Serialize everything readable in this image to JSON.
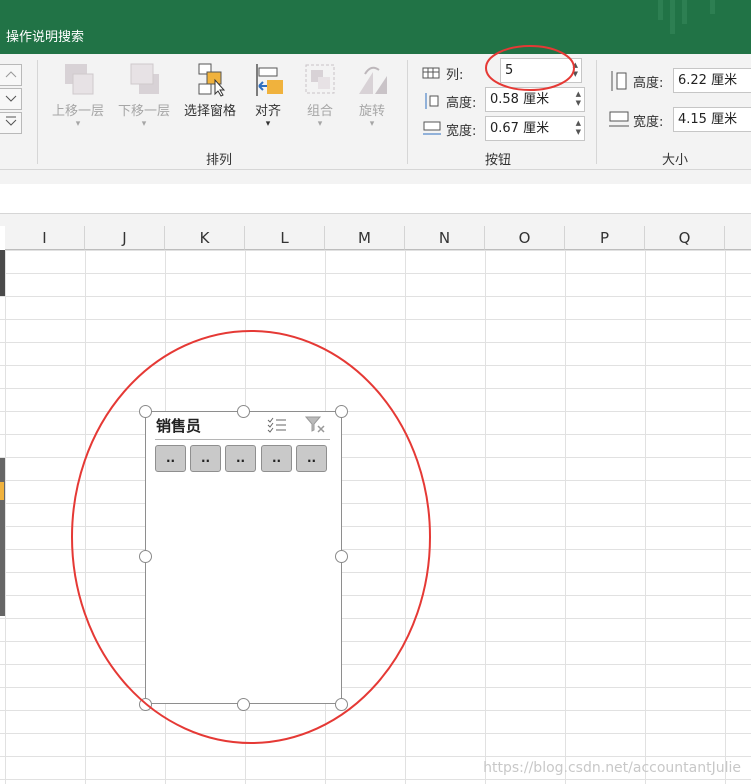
{
  "title_bar": {
    "tell_me": "操作说明搜索"
  },
  "ribbon": {
    "arrange": {
      "group_label": "排列",
      "bring_forward": "上移一层",
      "send_backward": "下移一层",
      "selection_pane": "选择窗格",
      "align": "对齐",
      "group": "组合",
      "rotate": "旋转"
    },
    "buttons": {
      "group_label": "按钮",
      "columns_label": "列:",
      "columns_value": "5",
      "height_label": "高度:",
      "height_value": "0.58 厘米",
      "width_label": "宽度:",
      "width_value": "0.67 厘米"
    },
    "size": {
      "group_label": "大小",
      "height_label": "高度:",
      "height_value": "6.22 厘米",
      "width_label": "宽度:",
      "width_value": "4.15 厘米"
    }
  },
  "sheet": {
    "columns": [
      "I",
      "J",
      "K",
      "L",
      "M",
      "N",
      "O",
      "P",
      "Q"
    ]
  },
  "slicer": {
    "title": "销售员",
    "items": [
      "..",
      "..",
      "..",
      "..",
      ".."
    ]
  },
  "watermark": "https://blog.csdn.net/accountantJulie",
  "colors": {
    "title_bar": "#217346",
    "annotation": "#e53935"
  }
}
